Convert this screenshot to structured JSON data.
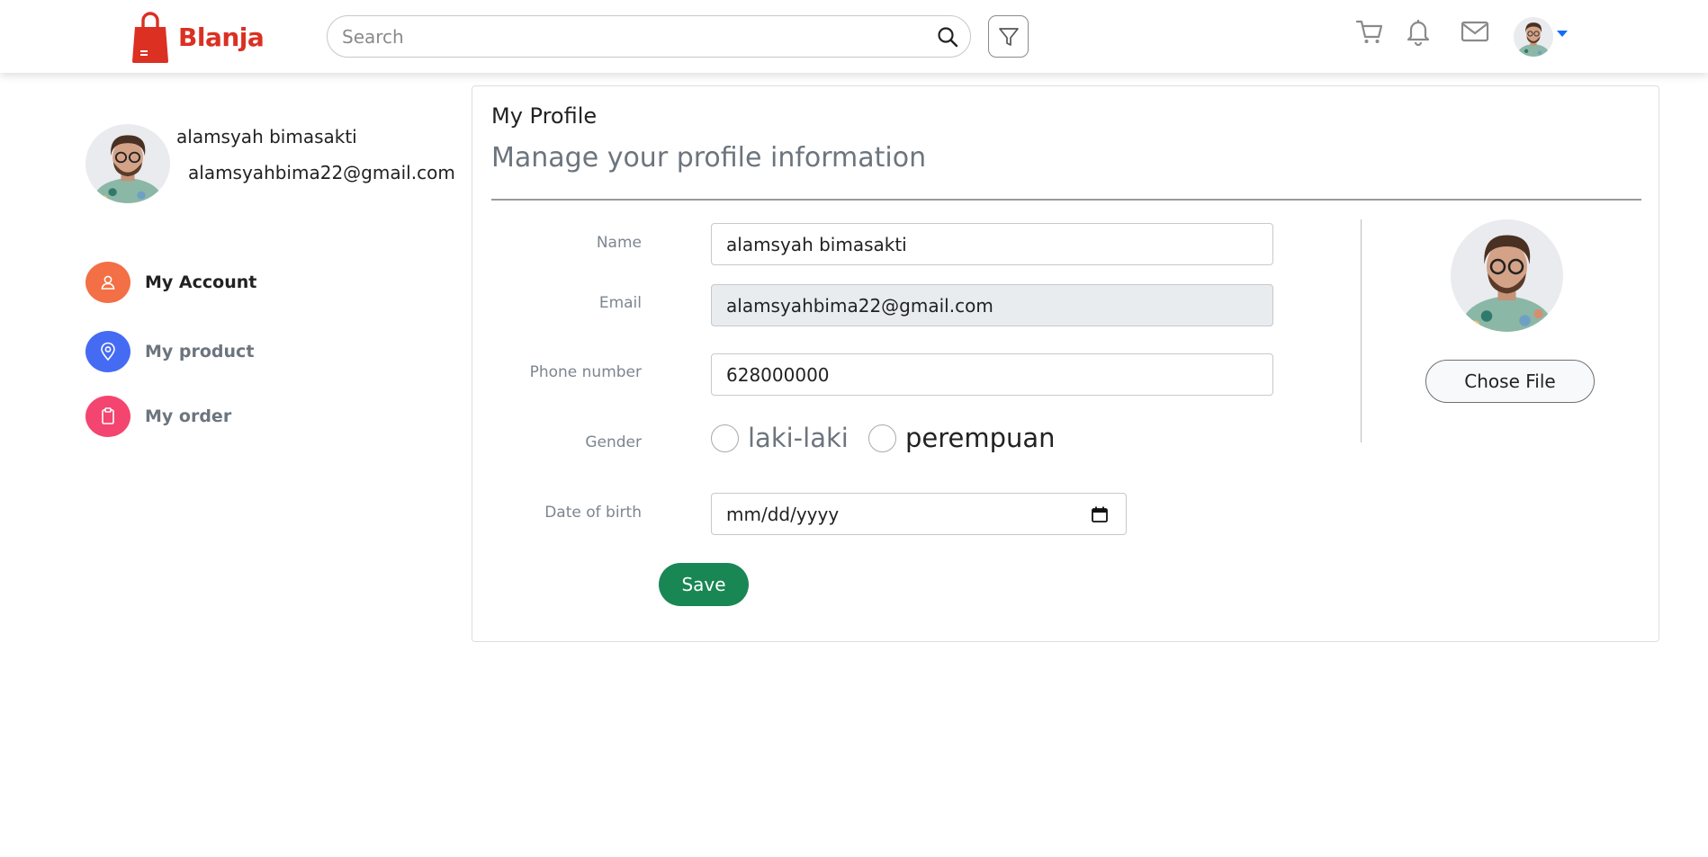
{
  "header": {
    "brand": "Blanja",
    "search_placeholder": "Search",
    "icons": [
      "search-icon",
      "filter-icon",
      "cart-icon",
      "bell-icon",
      "mail-icon",
      "avatar",
      "chevron-down-icon"
    ],
    "accent_color": "#db3022"
  },
  "sidebar": {
    "user_name": "alamsyah bimasakti",
    "user_email": "alamsyahbima22@gmail.com",
    "items": [
      {
        "label": "My Account",
        "icon": "user-icon",
        "color": "#f36f45",
        "active": true
      },
      {
        "label": "My product",
        "icon": "location-pin-icon",
        "color": "#456bf3",
        "active": false
      },
      {
        "label": "My order",
        "icon": "clipboard-icon",
        "color": "#f3456f",
        "active": false
      }
    ]
  },
  "main": {
    "title": "My Profile",
    "subtitle": "Manage your profile information",
    "fields": {
      "name": {
        "label": "Name",
        "value": "alamsyah bimasakti"
      },
      "email": {
        "label": "Email",
        "value": "alamsyahbima22@gmail.com",
        "disabled": true
      },
      "phone": {
        "label": "Phone number",
        "value": "628000000"
      },
      "gender": {
        "label": "Gender",
        "options": [
          "laki-laki",
          "perempuan"
        ],
        "selected": null
      },
      "dob": {
        "label": "Date of birth",
        "placeholder": "mm/dd/yyyy"
      }
    },
    "save_label": "Save",
    "choose_file_label": "Chose File",
    "save_color": "#198754"
  }
}
